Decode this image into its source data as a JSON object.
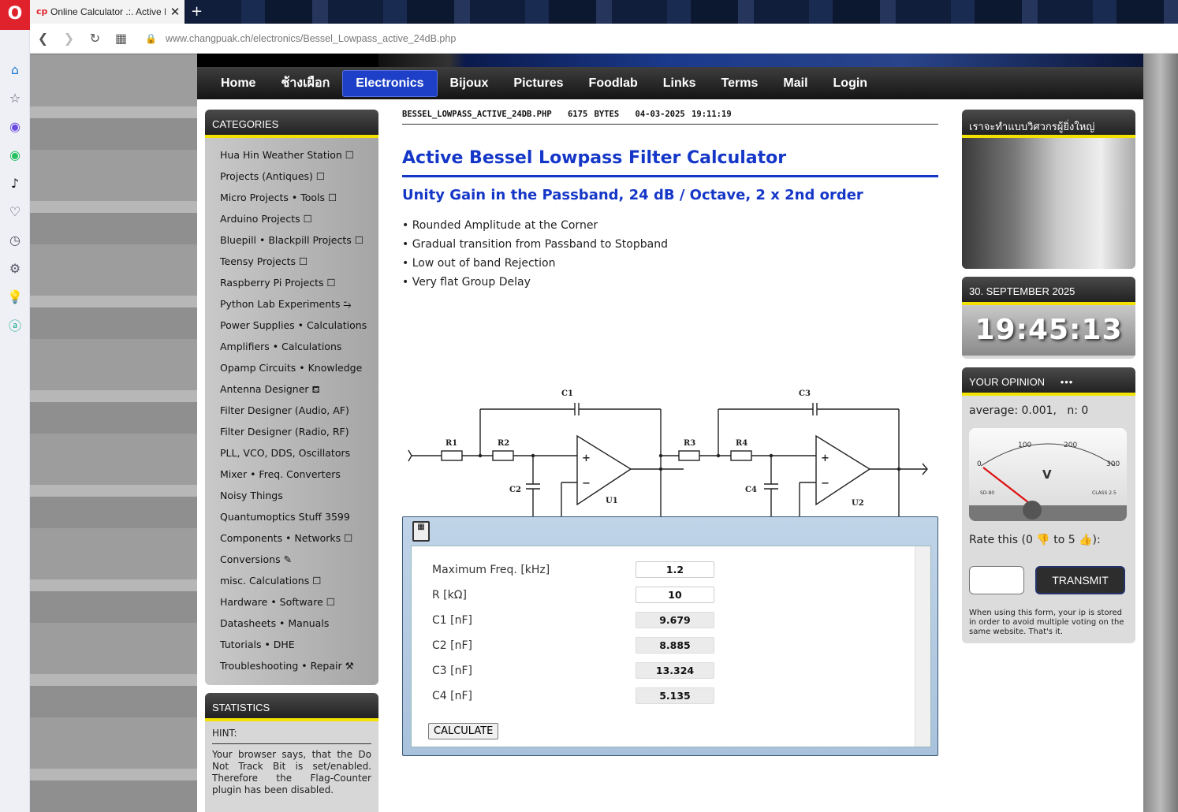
{
  "browser": {
    "tab_title": "Online Calculator .:. Active B",
    "url_domain": "www.changpuak.ch",
    "url_path": "/electronics/Bessel_Lowpass_active_24dB.php"
  },
  "menu": [
    "Home",
    "ช้างเผือก",
    "Electronics",
    "Bijoux",
    "Pictures",
    "Foodlab",
    "Links",
    "Terms",
    "Mail",
    "Login"
  ],
  "categories": {
    "title": "CATEGORIES",
    "items": [
      "Hua Hin Weather Station ☐",
      "Projects (Antiques) ☐",
      "Micro Projects • Tools ☐",
      "Arduino Projects ☐",
      "Bluepill • Blackpill Projects ☐",
      "Teensy Projects ☐",
      "Raspberry Pi Projects ☐",
      "Python Lab Experiments ⥲",
      "Power Supplies • Calculations",
      "Amplifiers • Calculations",
      "Opamp Circuits • Knowledge",
      "Antenna Designer ⛾",
      "Filter Designer (Audio, AF)",
      "Filter Designer (Radio, RF)",
      "PLL, VCO, DDS, Oscillators",
      "Mixer • Freq. Converters",
      "Noisy Things",
      "Quantumoptics Stuff 3599",
      "Components • Networks ☐",
      "Conversions ✎",
      "misc. Calculations ☐",
      "Hardware • Software ☐",
      "Datasheets • Manuals",
      "Tutorials • DHE",
      "Troubleshooting • Repair ⚒"
    ]
  },
  "statistics": {
    "title": "STATISTICS",
    "hint": "HINT:",
    "text": "Your browser says, that the Do Not Track Bit is set/enabled. Therefore the Flag-Counter plugin has been disabled."
  },
  "file_info": {
    "name": "BESSEL_LOWPASS_ACTIVE_24DB.PHP",
    "size": "6175 BYTES",
    "date": "04-03-2025 19:11:19"
  },
  "title": "Active Bessel Lowpass Filter Calculator",
  "subtitle": "Unity Gain in the Passband, 24 dB / Octave, 2 x 2nd order",
  "bullets": [
    "• Rounded Amplitude at the Corner",
    "• Gradual transition from Passband to Stopband",
    "• Low out of band Rejection",
    "• Very flat Group Delay"
  ],
  "schematic_labels": {
    "c1": "C1",
    "c2": "C2",
    "c3": "C3",
    "c4": "C4",
    "r1": "R1",
    "r2": "R2",
    "r3": "R3",
    "r4": "R4",
    "u1": "U1",
    "u2": "U2"
  },
  "calculator": {
    "rows": [
      {
        "label": "Maximum Freq. [kHz]",
        "value": "1.2",
        "editable": true
      },
      {
        "label": "R [kΩ]",
        "value": "10",
        "editable": true
      },
      {
        "label": "C1 [nF]",
        "value": "9.679",
        "editable": false
      },
      {
        "label": "C2 [nF]",
        "value": "8.885",
        "editable": false
      },
      {
        "label": "C3 [nF]",
        "value": "13.324",
        "editable": false
      },
      {
        "label": "C4 [nF]",
        "value": "5.135",
        "editable": false
      }
    ],
    "button": "CALCULATE"
  },
  "right": {
    "photo_title": "เราจะทำแบบวิศวกรผู้ยิ่งใหญ่",
    "date": "30. SEPTEMBER 2025",
    "time": "19:45:13",
    "opinion_title": "YOUR OPINION",
    "opinion_dots": "•••",
    "average": "average: 0.001,   n: 0",
    "meter_unit": "V",
    "meter_ticks": [
      "0",
      "100",
      "200",
      "300"
    ],
    "meter_left": "SD-80",
    "meter_right": "CLASS 2.5",
    "rate": "Rate this (0 👎 to 5 👍):",
    "transmit": "TRANSMIT",
    "note": "When using this form, your ip is stored in order to avoid multiple voting on the same website. That's it."
  }
}
